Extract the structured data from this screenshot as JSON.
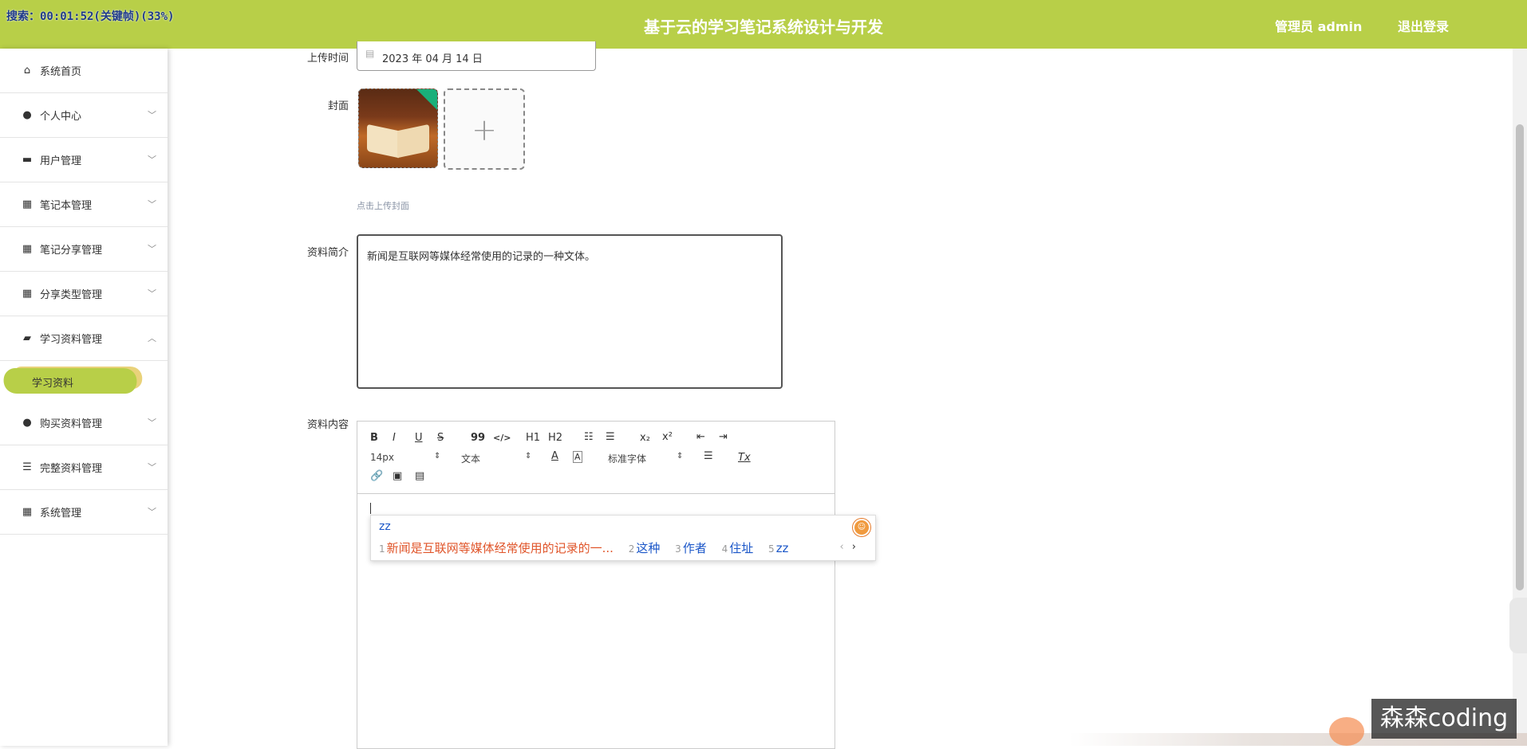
{
  "header": {
    "recording": "搜索：00:01:52(关键帧)(33%)",
    "title": "基于云的学习笔记系统设计与开发",
    "user": "管理员 admin",
    "logout": "退出登录"
  },
  "sidebar": {
    "items": [
      {
        "label": "系统首页",
        "icon": "home-icon"
      },
      {
        "label": "个人中心",
        "icon": "user-icon"
      },
      {
        "label": "用户管理",
        "icon": "briefcase-icon"
      },
      {
        "label": "笔记本管理",
        "icon": "grid-icon"
      },
      {
        "label": "笔记分享管理",
        "icon": "grid-icon"
      },
      {
        "label": "分享类型管理",
        "icon": "grid-icon"
      },
      {
        "label": "学习资料管理",
        "icon": "folder-icon"
      },
      {
        "label": "购买资料管理",
        "icon": "user-icon"
      },
      {
        "label": "完整资料管理",
        "icon": "list-icon"
      },
      {
        "label": "系统管理",
        "icon": "grid-icon"
      }
    ],
    "active_sub": "学习资料"
  },
  "form": {
    "upload_time_label": "上传时间",
    "upload_time_value": "2023 年 04 月 14 日",
    "cover_label": "封面",
    "cover_hint": "点击上传封面",
    "summary_label": "资料简介",
    "summary_value": "新闻是互联网等媒体经常使用的记录的一种文体。",
    "content_label": "资料内容"
  },
  "editor": {
    "toolbar": {
      "bold": "B",
      "italic": "I",
      "underline": "U",
      "strike": "S",
      "quote": "99",
      "code": "</>",
      "h1": "H1",
      "h2": "H2",
      "sub": "x₂",
      "sup": "x²",
      "font_size": "14px",
      "format": "文本",
      "font_family": "标准字体",
      "clear": "Tx"
    }
  },
  "ime": {
    "typed": "zz",
    "candidates": [
      {
        "n": "1",
        "text": "新闻是互联网等媒体经常使用的记录的一..."
      },
      {
        "n": "2",
        "text": "这种"
      },
      {
        "n": "3",
        "text": "作者"
      },
      {
        "n": "4",
        "text": "住址"
      },
      {
        "n": "5",
        "text": "zz"
      }
    ],
    "prev": "‹",
    "next": "›"
  },
  "watermark": "森森coding",
  "colors": {
    "accent": "#b8cf48",
    "candidate_first": "#e0552a",
    "candidate": "#1a56c8"
  }
}
